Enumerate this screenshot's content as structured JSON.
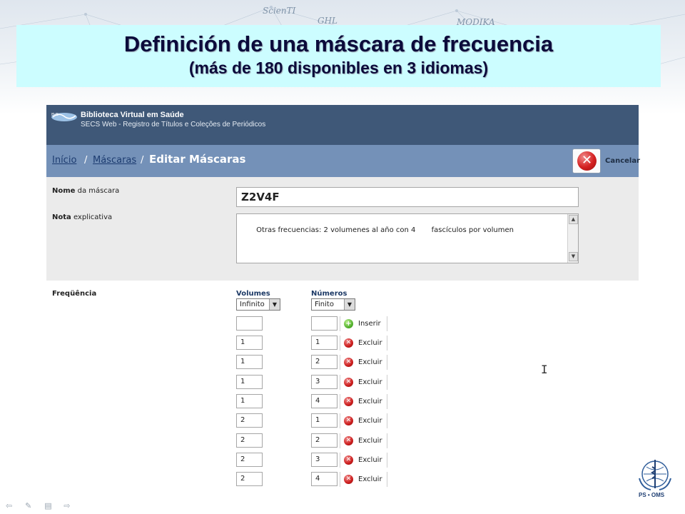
{
  "slide": {
    "title": "Definición de una máscara de frecuencia",
    "subtitle": "(más de 180 disponibles en 3 idiomas)",
    "background_words": [
      "ScienTI",
      "GHL",
      "MODIKA"
    ],
    "footer_logo_label": "PS • OMS",
    "nav_icons": [
      "back-arrow-icon",
      "pen-icon",
      "list-icon",
      "forward-arrow-icon"
    ]
  },
  "app": {
    "title": "Biblioteca Virtual em Saúde",
    "subtitle": "SECS Web - Registro de Títulos e Coleções de Periódicos",
    "breadcrumb": {
      "home": "Início",
      "sep1": "/",
      "masks": "Máscaras",
      "sep2": "/",
      "current": "Editar Máscaras"
    },
    "cancel_label": "Cancelar",
    "form": {
      "name_label_bold": "Nome",
      "name_label_rest": " da máscara",
      "name_value": "Z2V4F",
      "note_label_bold": "Nota",
      "note_label_rest": " explicativa",
      "note_value": "Otras frecuencias: 2 volumenes al año con 4       fascículos por volumen",
      "frequency_label": "Freqüência"
    },
    "frequency": {
      "volumes_header": "Volumes",
      "numbers_header": "Números",
      "volumes_select": "Infinito",
      "numbers_select": "Finito",
      "insert_label": "Inserir",
      "delete_label": "Excluir",
      "rows": [
        {
          "volume": "1",
          "number": "1"
        },
        {
          "volume": "1",
          "number": "2"
        },
        {
          "volume": "1",
          "number": "3"
        },
        {
          "volume": "1",
          "number": "4"
        },
        {
          "volume": "2",
          "number": "1"
        },
        {
          "volume": "2",
          "number": "2"
        },
        {
          "volume": "2",
          "number": "3"
        },
        {
          "volume": "2",
          "number": "4"
        }
      ]
    }
  },
  "colors": {
    "title_box": "#ccfdff",
    "header_bg": "#3f5878",
    "breadcrumb_bg": "#7491b8",
    "form_bg": "#ebebeb",
    "delete_red": "#cc1d1d",
    "insert_green": "#4aaa25"
  }
}
